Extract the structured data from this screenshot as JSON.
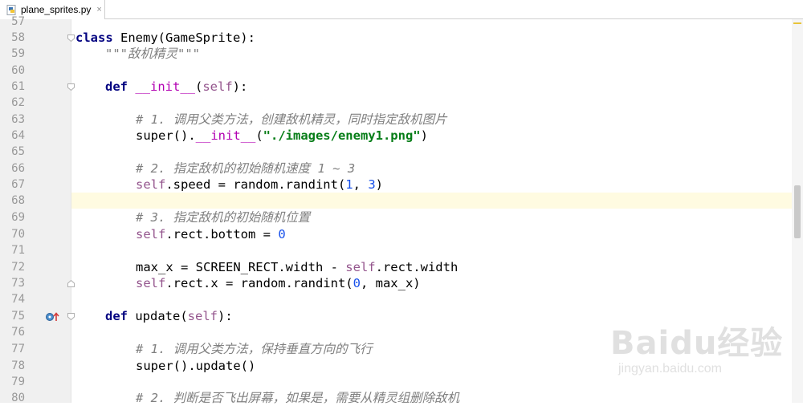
{
  "tab": {
    "filename": "plane_sprites.py",
    "close": "×"
  },
  "lines": [
    {
      "num": "57"
    },
    {
      "num": "58"
    },
    {
      "num": "59"
    },
    {
      "num": "60"
    },
    {
      "num": "61"
    },
    {
      "num": "62"
    },
    {
      "num": "63"
    },
    {
      "num": "64"
    },
    {
      "num": "65"
    },
    {
      "num": "66"
    },
    {
      "num": "67"
    },
    {
      "num": "68"
    },
    {
      "num": "69"
    },
    {
      "num": "70"
    },
    {
      "num": "71"
    },
    {
      "num": "72"
    },
    {
      "num": "73"
    },
    {
      "num": "74"
    },
    {
      "num": "75"
    },
    {
      "num": "76"
    },
    {
      "num": "77"
    },
    {
      "num": "78"
    },
    {
      "num": "79"
    },
    {
      "num": "80"
    }
  ],
  "code": {
    "l58_kw": "class",
    "l58_rest": " Enemy(GameSprite):",
    "l59": "\"\"\"敌机精灵\"\"\"",
    "l61_kw": "def",
    "l61_name": "__init__",
    "l61_open": "(",
    "l61_self": "self",
    "l61_close": "):",
    "l63": "# 1. 调用父类方法，创建敌机精灵，同时指定敌机图片",
    "l64_a": "super().",
    "l64_b": "__init__",
    "l64_c": "(",
    "l64_str": "\"./images/enemy1.png\"",
    "l64_d": ")",
    "l66": "# 2. 指定敌机的初始随机速度 1 ~ 3",
    "l67_self": "self",
    "l67_a": ".speed = random.randint(",
    "l67_n1": "1",
    "l67_b": ", ",
    "l67_n2": "3",
    "l67_c": ")",
    "l69": "# 3. 指定敌机的初始随机位置",
    "l70_self": "self",
    "l70_a": ".rect.bottom = ",
    "l70_n": "0",
    "l72_a": "max_x = SCREEN_RECT.width - ",
    "l72_self": "self",
    "l72_b": ".rect.width",
    "l73_self": "self",
    "l73_a": ".rect.x = random.randint(",
    "l73_n": "0",
    "l73_b": ", max_x)",
    "l75_kw": "def",
    "l75_a": " update(",
    "l75_self": "self",
    "l75_b": "):",
    "l77": "# 1. 调用父类方法，保持垂直方向的飞行",
    "l78": "super().update()",
    "l80": "# 2. 判断是否飞出屏幕，如果是，需要从精灵组删除敌机"
  },
  "watermark": {
    "brand": "Baidu经验",
    "url": "jingyan.baidu.com"
  },
  "colors": {
    "keyword": "#000080",
    "self": "#94558d",
    "comment": "#808080",
    "string": "#067d17",
    "number": "#1750eb",
    "highlight": "#fffbe1"
  }
}
